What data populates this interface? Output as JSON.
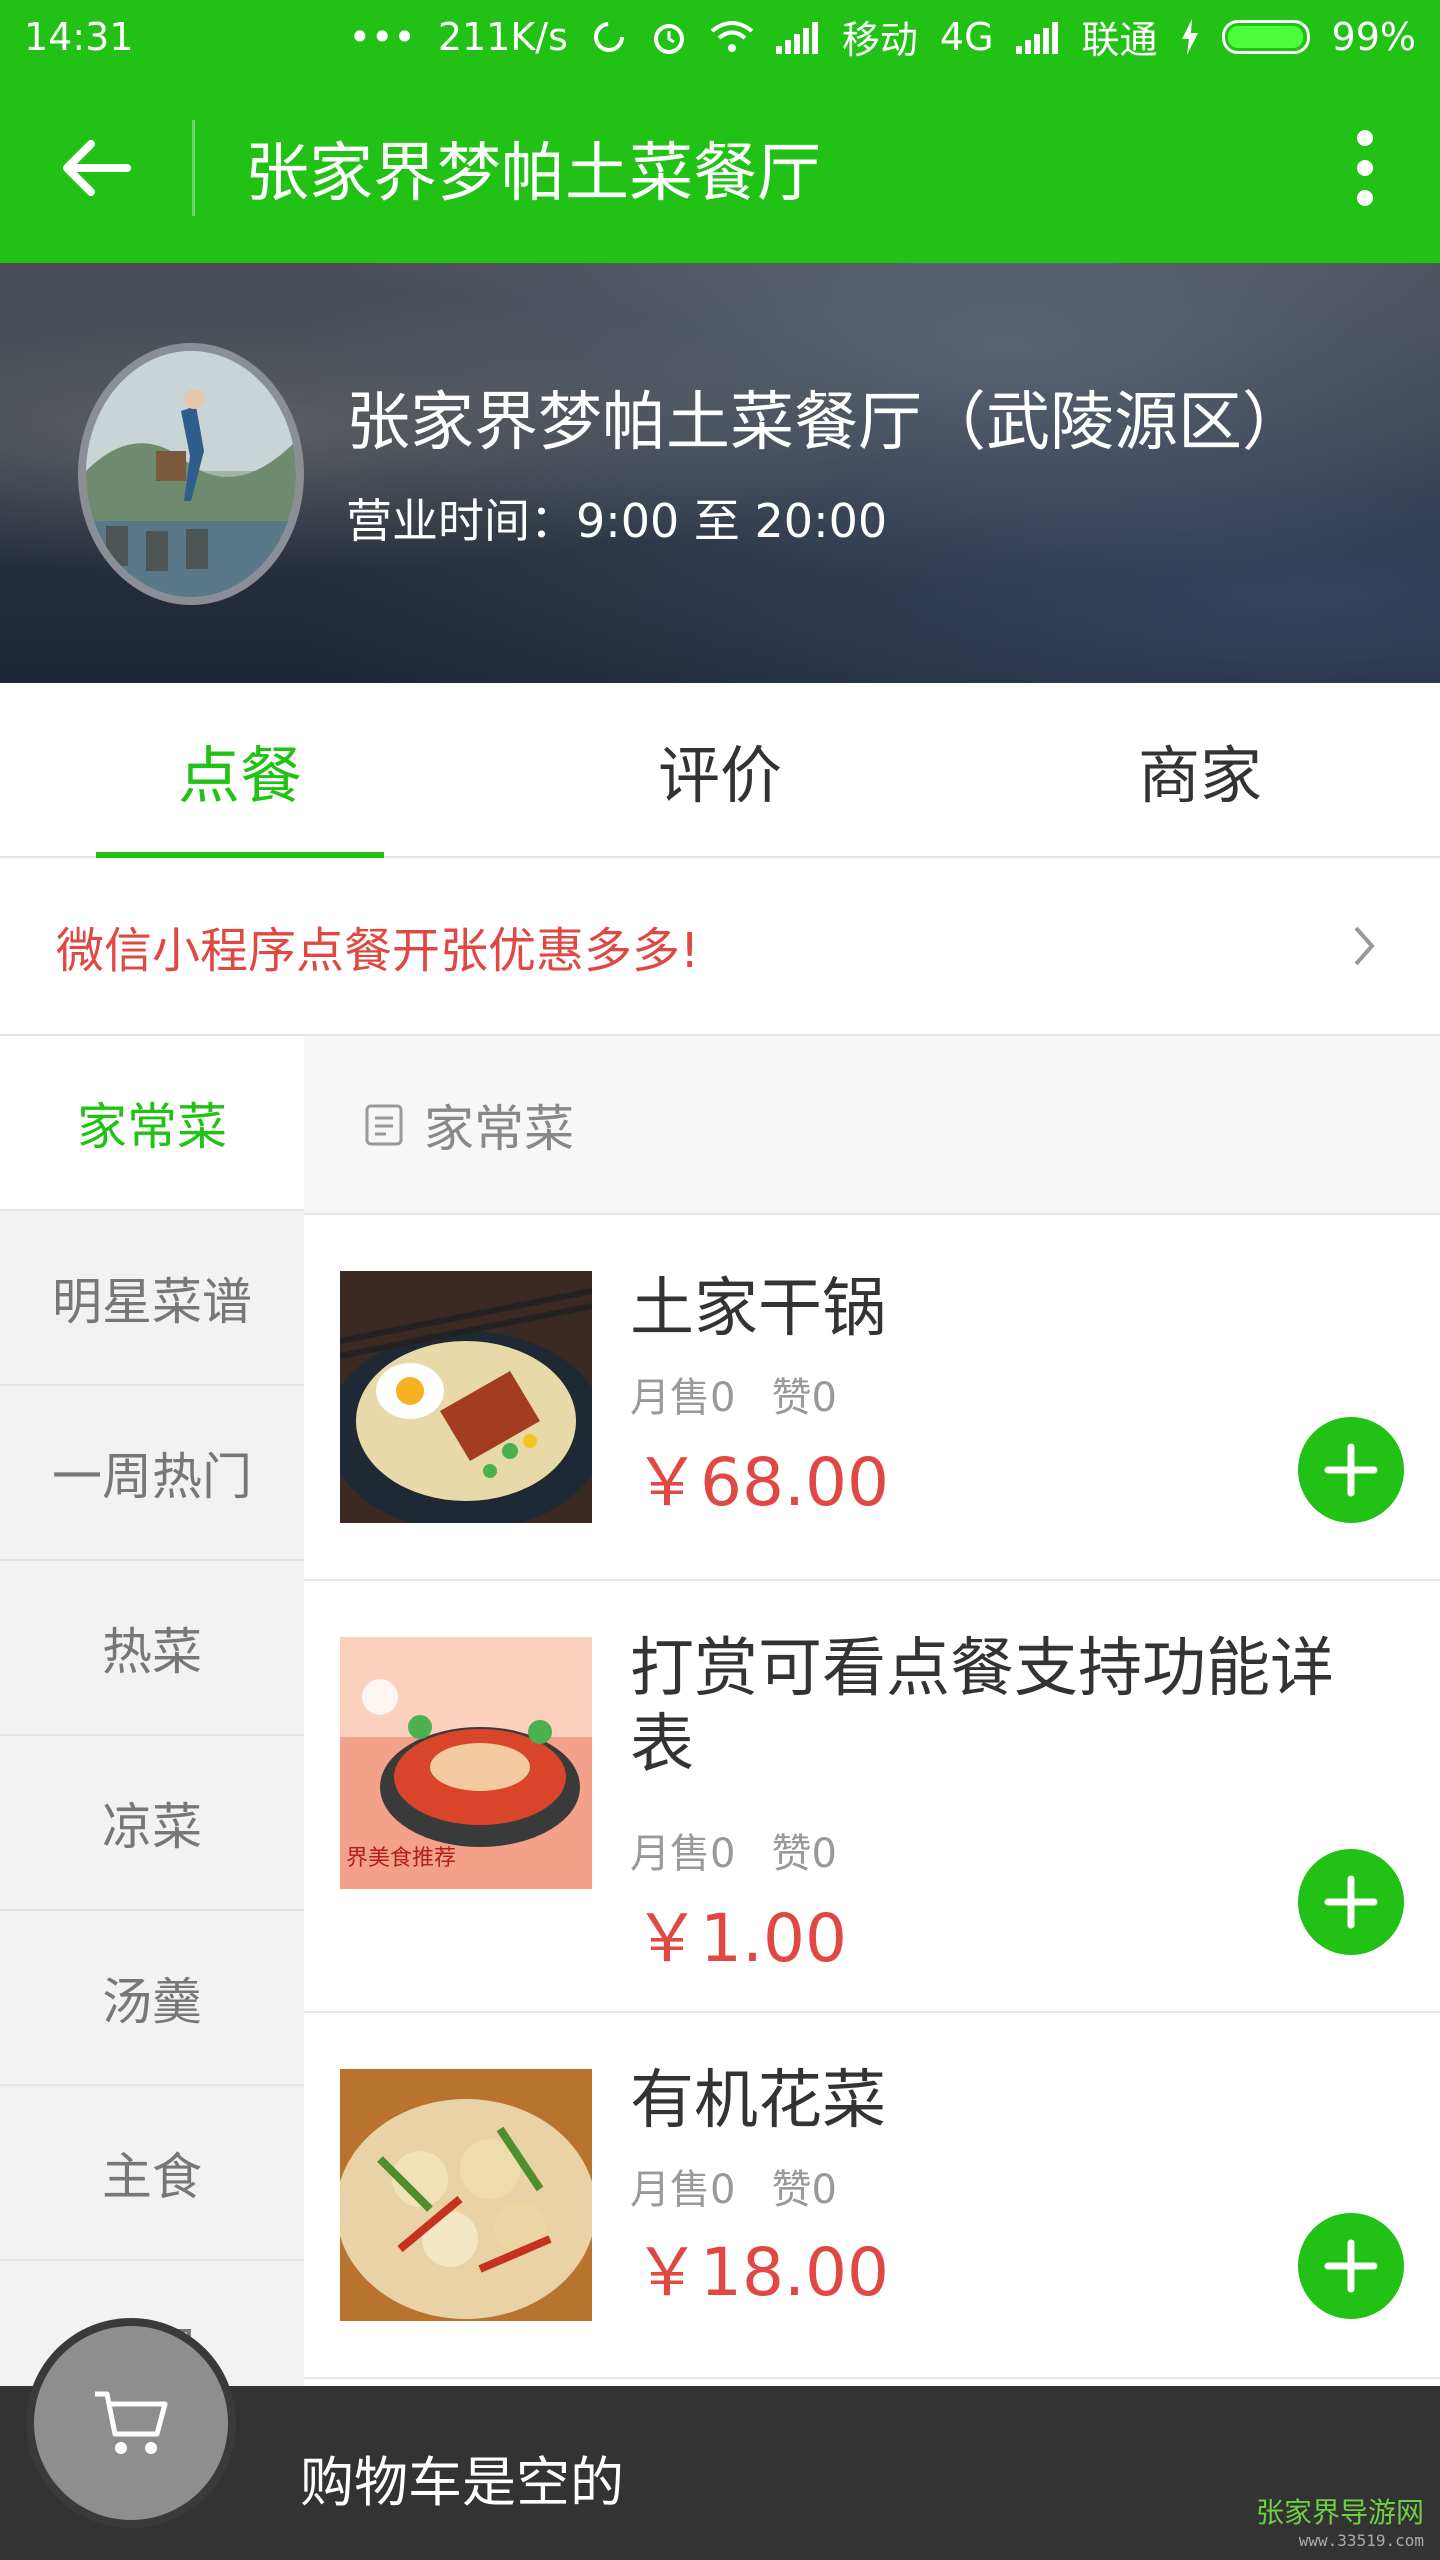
{
  "status_bar": {
    "time": "14:31",
    "speed": "211K/s",
    "carrier1": "移动",
    "network": "4G",
    "carrier2": "联通",
    "battery": "99%",
    "battery_level": 0.99
  },
  "titlebar": {
    "title": "张家界梦帕土菜餐厅"
  },
  "store": {
    "name": "张家界梦帕土菜餐厅（武陵源区）",
    "hours": "营业时间：9:00 至 20:00"
  },
  "tabs": [
    {
      "label": "点餐",
      "active": true
    },
    {
      "label": "评价",
      "active": false
    },
    {
      "label": "商家",
      "active": false
    }
  ],
  "notice": {
    "text": "微信小程序点餐开张优惠多多!"
  },
  "categories": [
    {
      "label": "家常菜",
      "active": true
    },
    {
      "label": "明星菜谱"
    },
    {
      "label": "一周热门"
    },
    {
      "label": "热菜"
    },
    {
      "label": "凉菜"
    },
    {
      "label": "汤羹"
    },
    {
      "label": "主食"
    },
    {
      "label": "饮品"
    }
  ],
  "section": {
    "title": "家常菜"
  },
  "items": [
    {
      "name": "土家干锅",
      "monthly_sales": "月售0",
      "likes": "赞0",
      "price": "￥68.00"
    },
    {
      "name": "打赏可看点餐支持功能详表",
      "monthly_sales": "月售0",
      "likes": "赞0",
      "price": "￥1.00"
    },
    {
      "name": "有机花菜",
      "monthly_sales": "月售0",
      "likes": "赞0",
      "price": "￥18.00"
    }
  ],
  "cart": {
    "empty_text": "购物车是空的"
  },
  "watermark": {
    "text": "张家界导游网",
    "url": "www.33519.com"
  },
  "colors": {
    "brand_green": "#22c115",
    "price_red": "#e04843",
    "cart_bar": "#333333"
  }
}
